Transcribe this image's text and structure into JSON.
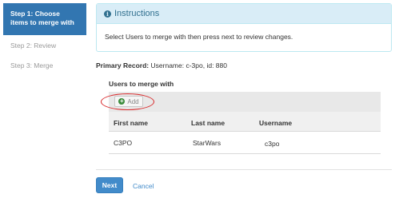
{
  "steps": [
    {
      "label": "Step 1: Choose items to merge with",
      "active": true
    },
    {
      "label": "Step 2: Review",
      "active": false
    },
    {
      "label": "Step 3: Merge",
      "active": false
    }
  ],
  "instructions": {
    "title": "Instructions",
    "icon": "info-icon",
    "body": "Select Users to merge with then press next to review changes."
  },
  "primary_record": {
    "label": "Primary Record:",
    "username_text": "Username: c-3po,",
    "id_text": "id: 880"
  },
  "users_section": {
    "label": "Users to merge with",
    "add_label": "Add",
    "add_icon": "plus-circle-icon",
    "columns": [
      "First name",
      "Last name",
      "Username"
    ],
    "rows": [
      [
        "C3PO",
        "StarWars",
        "c3po"
      ]
    ]
  },
  "actions": {
    "next_label": "Next",
    "cancel_label": "Cancel"
  },
  "colors": {
    "accent": "#428bca",
    "active_step": "#3276b1",
    "info_bg": "#d9edf7",
    "highlight_oval": "#d8282a"
  }
}
